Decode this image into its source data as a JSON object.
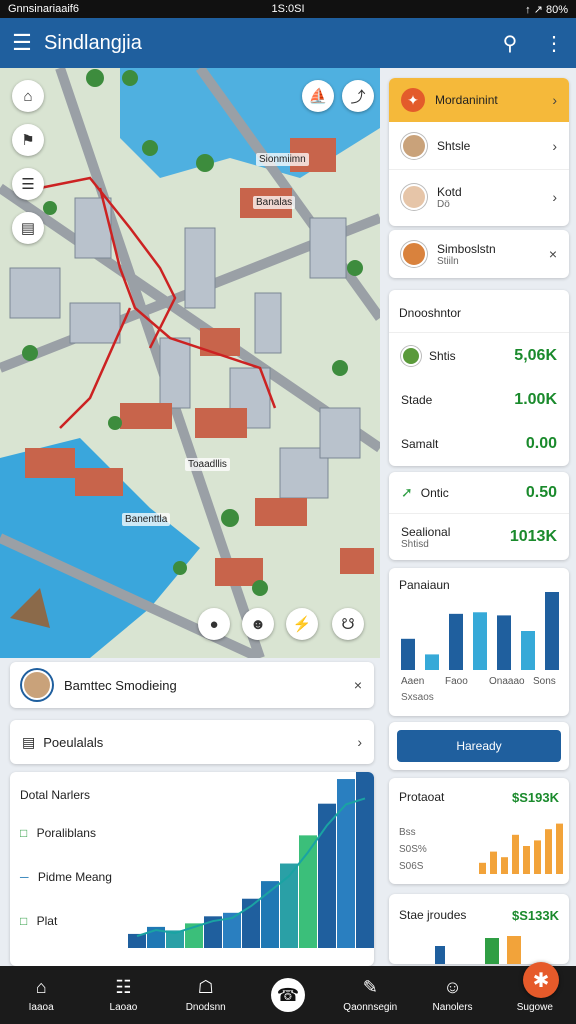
{
  "status": {
    "left": "Gnnsinariaaif6",
    "center": "1S:0SI",
    "right": "↑ ↗ 80%"
  },
  "appbar": {
    "title": "Sindlangjia",
    "menu_icon": "menu-icon",
    "search_icon": "search-icon",
    "more_icon": "more-vert-icon"
  },
  "map": {
    "labels": [
      "Sionmiimn",
      "Banalas",
      "Toaadllis",
      "Banenttla"
    ],
    "left_buttons": [
      "building-icon",
      "home-icon",
      "layers-icon",
      "doc-icon"
    ],
    "top_buttons": [
      "road-icon",
      "chart-icon"
    ],
    "bottom_buttons": [
      "pin-icon",
      "user-icon",
      "bolt-icon",
      "shield-icon"
    ]
  },
  "right_column": {
    "notification": {
      "title": "Mordaninint",
      "icon": "alert-icon"
    },
    "contacts": [
      {
        "name": "Shtsle",
        "sub": ""
      },
      {
        "name": "Kotd",
        "sub": "Dö"
      },
      {
        "name": "Simboslstn",
        "sub": "Stiiln"
      }
    ],
    "stats_title": "Dnooshntor",
    "stats": [
      {
        "label": "Shtis",
        "value": "5,06K"
      },
      {
        "label": "Stade",
        "value": "1.00K"
      },
      {
        "label": "Samalt",
        "value": "0.00"
      }
    ],
    "mini": [
      {
        "label": "Ontic",
        "value": "0.50"
      },
      {
        "label": "Sealional",
        "sub": "Shtisd",
        "value": "1013K"
      }
    ],
    "barcard": {
      "title": "Panaiaun",
      "xlabels": [
        "Aaen",
        "Faoo",
        "Onaaao",
        "Sons"
      ],
      "sub": "Sxsaos"
    },
    "action_button": "Haready",
    "promo": {
      "title": "Protaoat",
      "value": "$S193K",
      "lines": [
        "Bss",
        "S0S%",
        "S06S"
      ]
    },
    "last": {
      "title": "Stae jroudes",
      "value": "$S133K"
    }
  },
  "bottom_left": {
    "profile": {
      "name": "Bamttec Smodieing"
    },
    "section": {
      "label": "Poeulalals"
    },
    "chart_card": {
      "title": "Dotal Narlers",
      "legend": [
        {
          "label": "Poraliblans",
          "color": "#2f9e44"
        },
        {
          "label": "Pidme Meang",
          "color": "#1f78b4"
        },
        {
          "label": "Plat",
          "color": "#2f9e44"
        }
      ]
    }
  },
  "chart_data": [
    {
      "type": "bar",
      "categories": [
        "Aaen",
        "Faoo",
        "Onaaao",
        "Sons"
      ],
      "series": [
        {
          "values": [
            40,
            20,
            72,
            74,
            70,
            50,
            100
          ]
        }
      ],
      "ylim": [
        0,
        100
      ]
    },
    {
      "type": "bar",
      "series": [
        {
          "values": [
            8,
            12,
            10,
            14,
            18,
            20,
            28,
            38,
            48,
            64,
            82,
            96,
            100
          ]
        }
      ],
      "ylim": [
        0,
        100
      ]
    },
    {
      "type": "bar",
      "series": [
        {
          "values": [
            20,
            40,
            30,
            70,
            50,
            60,
            80,
            90
          ]
        }
      ],
      "ylim": [
        0,
        100
      ]
    }
  ],
  "bottom_nav": [
    {
      "label": "Iaaoa",
      "icon": "home-icon"
    },
    {
      "label": "Laoao",
      "icon": "calendar-icon"
    },
    {
      "label": "Dnodsnn",
      "icon": "gift-icon"
    },
    {
      "label": "",
      "icon": "phone-icon"
    },
    {
      "label": "Qaonnsegin",
      "icon": "edit-icon"
    },
    {
      "label": "Nanolers",
      "icon": "people-icon"
    },
    {
      "label": "Sugowe",
      "icon": "star-icon"
    }
  ]
}
